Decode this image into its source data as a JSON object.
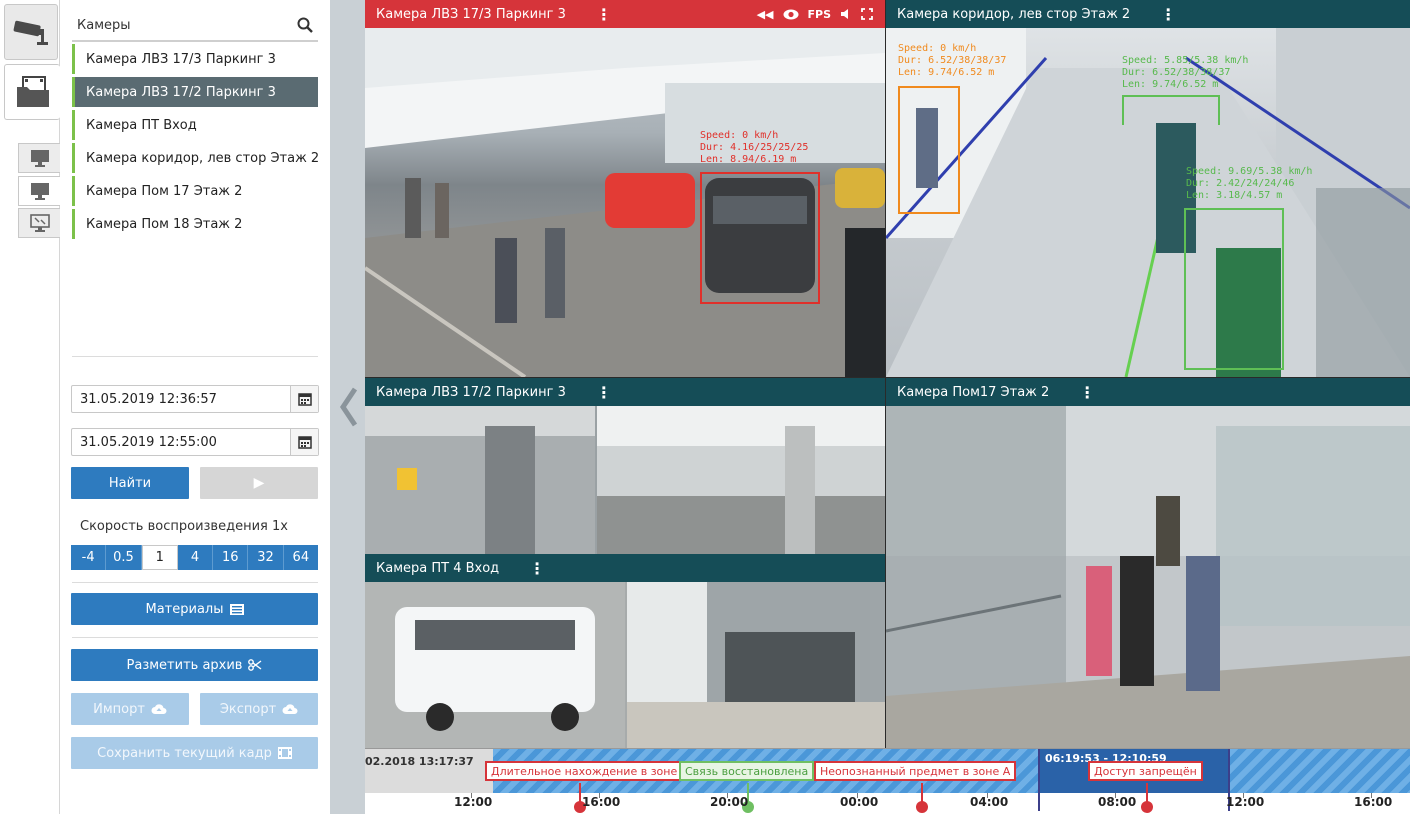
{
  "panel": {
    "search_label": "Камеры",
    "cameras": [
      {
        "label": "Камера ЛВЗ 17/3 Паркинг 3",
        "selected": false
      },
      {
        "label": "Камера ЛВЗ 17/2 Паркинг 3",
        "selected": true
      },
      {
        "label": "Камера ПТ Вход",
        "selected": false
      },
      {
        "label": "Камера коридор, лев стор Этаж 2",
        "selected": false
      },
      {
        "label": "Камера Пом 17 Этаж 2",
        "selected": false
      },
      {
        "label": "Камера Пом 18 Этаж 2",
        "selected": false
      }
    ],
    "date_from": "31.05.2019 12:36:57",
    "date_to": "31.05.2019 12:55:00",
    "find_label": "Найти",
    "play_glyph": "▶",
    "speed_label": "Скорость воспроизведения 1x",
    "speeds": [
      "-4",
      "0.5",
      "1",
      "4",
      "16",
      "32",
      "64"
    ],
    "active_speed": "1",
    "materials_label": "Материалы",
    "mark_archive_label": "Разметить архив",
    "import_label": "Импорт",
    "export_label": "Экспорт",
    "save_frame_label": "Сохранить текущий кадр"
  },
  "tiles": {
    "t1": {
      "title": "Камера ЛВЗ 17/3 Паркинг 3",
      "fps": "FPS",
      "alarm": true
    },
    "t2": {
      "title": "Камера коридор, лев стор Этаж 2"
    },
    "t3": {
      "title": "Камера ЛВЗ 17/2 Паркинг 3"
    },
    "t4": {
      "title": "Камера ПТ 4 Вход"
    },
    "t5": {
      "title": "Камера Пом17 Этаж 2"
    }
  },
  "overlays": {
    "car": [
      "Speed: 0 km/h",
      "Dur: 4.16/25/25/25",
      "Len: 8.94/6.19 m"
    ],
    "person_orange": [
      "Speed: 0 km/h",
      "Dur: 6.52/38/38/37",
      "Len: 9.74/6.52 m"
    ],
    "person_green_top": [
      "Speed: 5.85/5.38 km/h",
      "Dur: 6.52/38/38/37",
      "Len: 9.74/6.52 m"
    ],
    "person_green_bottom": [
      "Speed: 9.69/5.38 km/h",
      "Dur: 2.42/24/24/46",
      "Len: 3.18/4.57 m"
    ]
  },
  "timeline": {
    "start_date": "02.2018 13:17:37",
    "range": "06:19:53 - 12:10:59",
    "events": [
      {
        "label": "Длительное нахождение в зоне",
        "type": "alarm"
      },
      {
        "label": "Связь восстановлена",
        "type": "ok"
      },
      {
        "label": "Неопознанный предмет в зоне А",
        "type": "alarm"
      },
      {
        "label": "Доступ запрещён",
        "type": "alarm"
      }
    ],
    "ticks": [
      "12:00",
      "16:00",
      "20:00",
      "00:00",
      "04:00",
      "08:00",
      "12:00",
      "16:00"
    ]
  },
  "colors": {
    "accent": "#2e7bbf",
    "tile_header": "#154d57",
    "alarm": "#d6343a",
    "ok": "#6fbf62",
    "camera_marker": "#7cc14a"
  }
}
